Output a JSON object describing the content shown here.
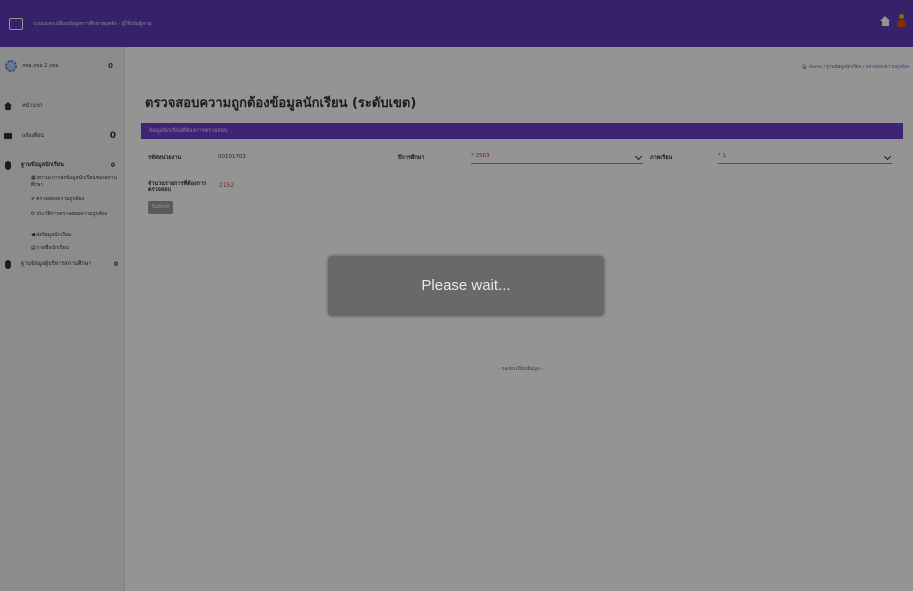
{
  "header": {
    "brand_text": "ระบบแลกเปลี่ยนข้อมูลการศึกษาพฤตจัง - ผู้ใช้เข้มผู้ลาน"
  },
  "sidebar": {
    "user_name": "ภจม.ภจม 2 ภจม",
    "user_badge": "0",
    "items": [
      {
        "icon": "home-icon",
        "label": "หน้าแรก",
        "badge": ""
      },
      {
        "icon": "mail-icon",
        "label": "แจ้งเตือน",
        "badge": "0"
      },
      {
        "icon": "database-icon",
        "label": "ฐานข้อมูลนักเรียน",
        "badge": "0"
      }
    ],
    "sub_items": [
      {
        "glyph": "▦",
        "label": "สถานะการส่งข้อมูลนักเรียนของสถานศึกษา"
      },
      {
        "glyph": "✔",
        "label": "ตรวจสอบความถูกต้อง"
      },
      {
        "glyph": "⟳",
        "label": "ประวัติการตรวจสอบความถูกต้อง"
      },
      {
        "glyph": "◀",
        "label": "ส่งข้อมูลนักเรียน"
      },
      {
        "glyph": "▤",
        "label": "รายชื่อนักเรียน"
      }
    ],
    "item4": {
      "icon": "database-icon",
      "label": "ฐานข้อมูลผู้บริหารสถานศึกษา",
      "badge": "0"
    }
  },
  "breadcrumb": {
    "home": "Home",
    "section": "ฐานข้อมูลนักเรียน",
    "current": "ตรวจสอบความถูกต้อง"
  },
  "main": {
    "title": "ตรวจสอบความถูกต้องข้อมูลนักเรียน (ระดับเขต)",
    "panel_title": "ข้อมูลนักเรียนที่ต้องการตรวจสอบ",
    "area_code_label": "รหัสหน่วยงาน",
    "area_code_value": "00101702",
    "year_label": "ปีการศึกษา",
    "year_value": "* 2563",
    "term_label": "ภาคเรียน",
    "term_value": "* 1",
    "count_label": "จำนวนรายการที่ต้องการตรวจสอบ",
    "count_value": "2152",
    "submit_label": "Submit",
    "footer": "- กองทะเบียนข้อมูล -"
  },
  "overlay": {
    "message": "Please wait..."
  }
}
